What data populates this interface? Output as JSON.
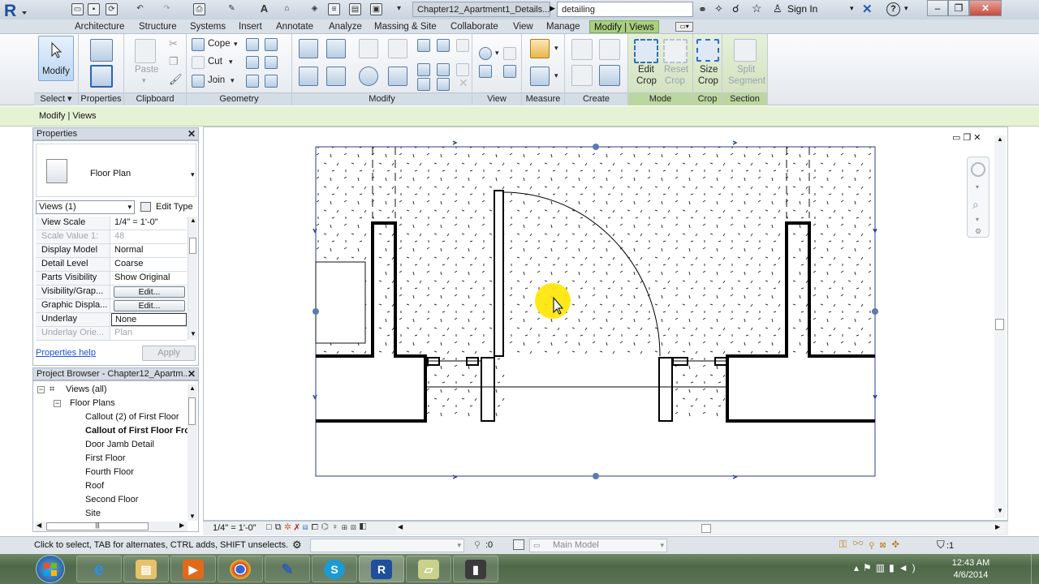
{
  "titlebar": {
    "document_title": "Chapter12_Apartment1_Details...",
    "search_value": "detailing",
    "sign_in": "Sign In",
    "help": "?"
  },
  "ribbon_tabs": [
    "Architecture",
    "Structure",
    "Systems",
    "Insert",
    "Annotate",
    "Analyze",
    "Massing & Site",
    "Collaborate",
    "View",
    "Manage",
    "Modify | Views"
  ],
  "ribbon": {
    "modify_label": "Modify",
    "paste_label": "Paste",
    "properties_label": "Properties",
    "cope_label": "Cope",
    "cut_label": "Cut",
    "join_label": "Join",
    "edit_crop_l1": "Edit",
    "edit_crop_l2": "Crop",
    "reset_crop_l1": "Reset",
    "reset_crop_l2": "Crop",
    "size_crop_l1": "Size",
    "size_crop_l2": "Crop",
    "split_segment_l1": "Split",
    "split_segment_l2": "Segment",
    "panels": {
      "select": "Select",
      "properties": "Properties",
      "clipboard": "Clipboard",
      "geometry": "Geometry",
      "modify": "Modify",
      "view": "View",
      "measure": "Measure",
      "create": "Create",
      "mode": "Mode",
      "crop": "Crop",
      "section": "Section"
    }
  },
  "context_bar": "Modify | Views",
  "properties": {
    "header": "Properties",
    "type_name": "Floor Plan",
    "views_selector": "Views (1)",
    "edit_type": "Edit Type",
    "rows": [
      {
        "key": "View Scale",
        "value": "1/4\" = 1'-0\""
      },
      {
        "key": "Scale Value    1:",
        "value": "48"
      },
      {
        "key": "Display Model",
        "value": "Normal"
      },
      {
        "key": "Detail Level",
        "value": "Coarse"
      },
      {
        "key": "Parts Visibility",
        "value": "Show Original"
      },
      {
        "key": "Visibility/Grap...",
        "value": "Edit..."
      },
      {
        "key": "Graphic Displa...",
        "value": "Edit..."
      },
      {
        "key": "Underlay",
        "value": "None"
      },
      {
        "key": "Underlay Orie...",
        "value": "Plan"
      }
    ],
    "help_link": "Properties help",
    "apply": "Apply"
  },
  "project_browser": {
    "header": "Project Browser - Chapter12_Apartm...",
    "views_all": "Views (all)",
    "floor_plans": "Floor Plans",
    "items": [
      "Callout (2) of First Floor",
      "Callout of First Floor Fro",
      "Door Jamb Detail",
      "First Floor",
      "Fourth Floor",
      "Roof",
      "Second Floor",
      "Site"
    ]
  },
  "view_bar": {
    "scale": "1/4\" = 1'-0\""
  },
  "status_bar": {
    "hint": "Click to select, TAB for alternates, CTRL adds, SHIFT unselects.",
    "zero": ":0",
    "model": "Main Model",
    "filter_count": ":1"
  },
  "taskbar": {
    "time": "12:43 AM",
    "date": "4/6/2014"
  }
}
